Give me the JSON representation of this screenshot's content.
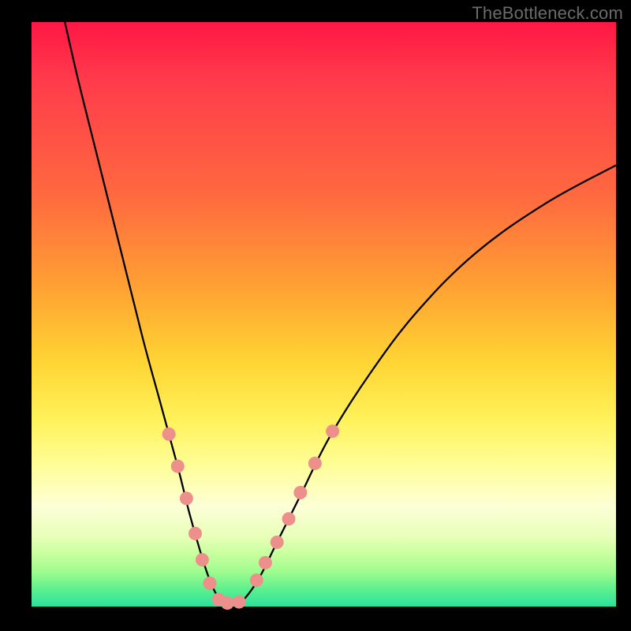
{
  "watermark": "TheBottleneck.com",
  "chart_data": {
    "type": "line",
    "title": "",
    "xlabel": "",
    "ylabel": "",
    "xlim": [
      0,
      100
    ],
    "ylim": [
      0,
      100
    ],
    "grid": false,
    "series": [
      {
        "name": "bottleneck-curve",
        "style": "black-thin",
        "points": [
          {
            "x": 5.7,
            "y": 100.0
          },
          {
            "x": 8.0,
            "y": 90.0
          },
          {
            "x": 11.0,
            "y": 78.0
          },
          {
            "x": 15.0,
            "y": 62.0
          },
          {
            "x": 19.0,
            "y": 46.0
          },
          {
            "x": 22.0,
            "y": 35.0
          },
          {
            "x": 25.0,
            "y": 24.0
          },
          {
            "x": 27.0,
            "y": 16.0
          },
          {
            "x": 29.0,
            "y": 9.0
          },
          {
            "x": 30.5,
            "y": 4.5
          },
          {
            "x": 32.0,
            "y": 1.5
          },
          {
            "x": 33.5,
            "y": 0.4
          },
          {
            "x": 35.0,
            "y": 0.4
          },
          {
            "x": 36.5,
            "y": 1.4
          },
          {
            "x": 39.0,
            "y": 5.0
          },
          {
            "x": 42.0,
            "y": 11.0
          },
          {
            "x": 46.0,
            "y": 19.0
          },
          {
            "x": 51.0,
            "y": 29.0
          },
          {
            "x": 58.0,
            "y": 40.0
          },
          {
            "x": 66.0,
            "y": 50.5
          },
          {
            "x": 76.0,
            "y": 60.5
          },
          {
            "x": 88.0,
            "y": 69.0
          },
          {
            "x": 100.0,
            "y": 75.5
          }
        ]
      },
      {
        "name": "estimate-markers-left",
        "style": "salmon-dots",
        "points": [
          {
            "x": 23.5,
            "y": 29.5
          },
          {
            "x": 25.0,
            "y": 24.0
          },
          {
            "x": 26.5,
            "y": 18.5
          },
          {
            "x": 28.0,
            "y": 12.5
          },
          {
            "x": 29.2,
            "y": 8.0
          },
          {
            "x": 30.5,
            "y": 4.0
          }
        ]
      },
      {
        "name": "estimate-markers-bottom",
        "style": "salmon-dots",
        "points": [
          {
            "x": 32.0,
            "y": 1.2
          },
          {
            "x": 33.5,
            "y": 0.6
          },
          {
            "x": 35.5,
            "y": 0.8
          }
        ]
      },
      {
        "name": "estimate-markers-right",
        "style": "salmon-dots",
        "points": [
          {
            "x": 38.5,
            "y": 4.5
          },
          {
            "x": 40.0,
            "y": 7.5
          },
          {
            "x": 42.0,
            "y": 11.0
          },
          {
            "x": 44.0,
            "y": 15.0
          },
          {
            "x": 46.0,
            "y": 19.5
          },
          {
            "x": 48.5,
            "y": 24.5
          },
          {
            "x": 51.5,
            "y": 30.0
          }
        ]
      }
    ]
  }
}
